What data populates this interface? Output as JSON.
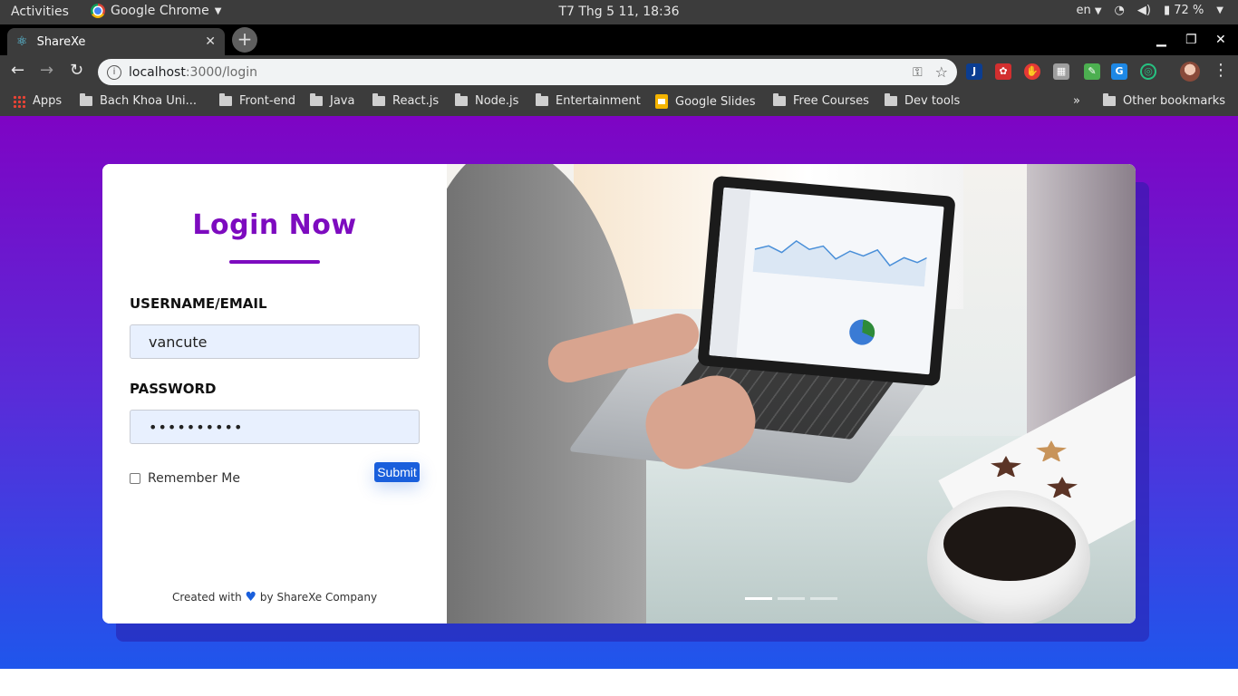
{
  "system_bar": {
    "activities": "Activities",
    "app_name": "Google Chrome",
    "clock": "T7 Thg 5 11, 18:36",
    "language": "en",
    "battery": "72 %"
  },
  "browser": {
    "tab": {
      "title": "ShareXe"
    },
    "address": {
      "host": "localhost",
      "path": ":3000/login"
    },
    "bookmarks": {
      "apps": "Apps",
      "items": [
        "Bach Khoa Uni...",
        "Front-end",
        "Java",
        "React.js",
        "Node.js",
        "Entertainment",
        "Google Slides",
        "Free Courses",
        "Dev tools"
      ],
      "overflow": "»",
      "other": "Other bookmarks"
    }
  },
  "login": {
    "title": "Login Now",
    "username_label": "USERNAME/EMAIL",
    "username_value": "vancute",
    "password_label": "PASSWORD",
    "password_value": "••••••••••",
    "remember_label": "Remember Me",
    "submit_label": "Submit",
    "footer_prefix": "Created with",
    "footer_suffix": "by ShareXe Company"
  },
  "carousel": {
    "slide_count": 3,
    "active_index": 0
  },
  "colors": {
    "accent_purple": "#7d0bbf",
    "accent_blue": "#1a5fdc",
    "gradient_top": "#7e04c4",
    "gradient_bottom": "#1f56ec"
  }
}
